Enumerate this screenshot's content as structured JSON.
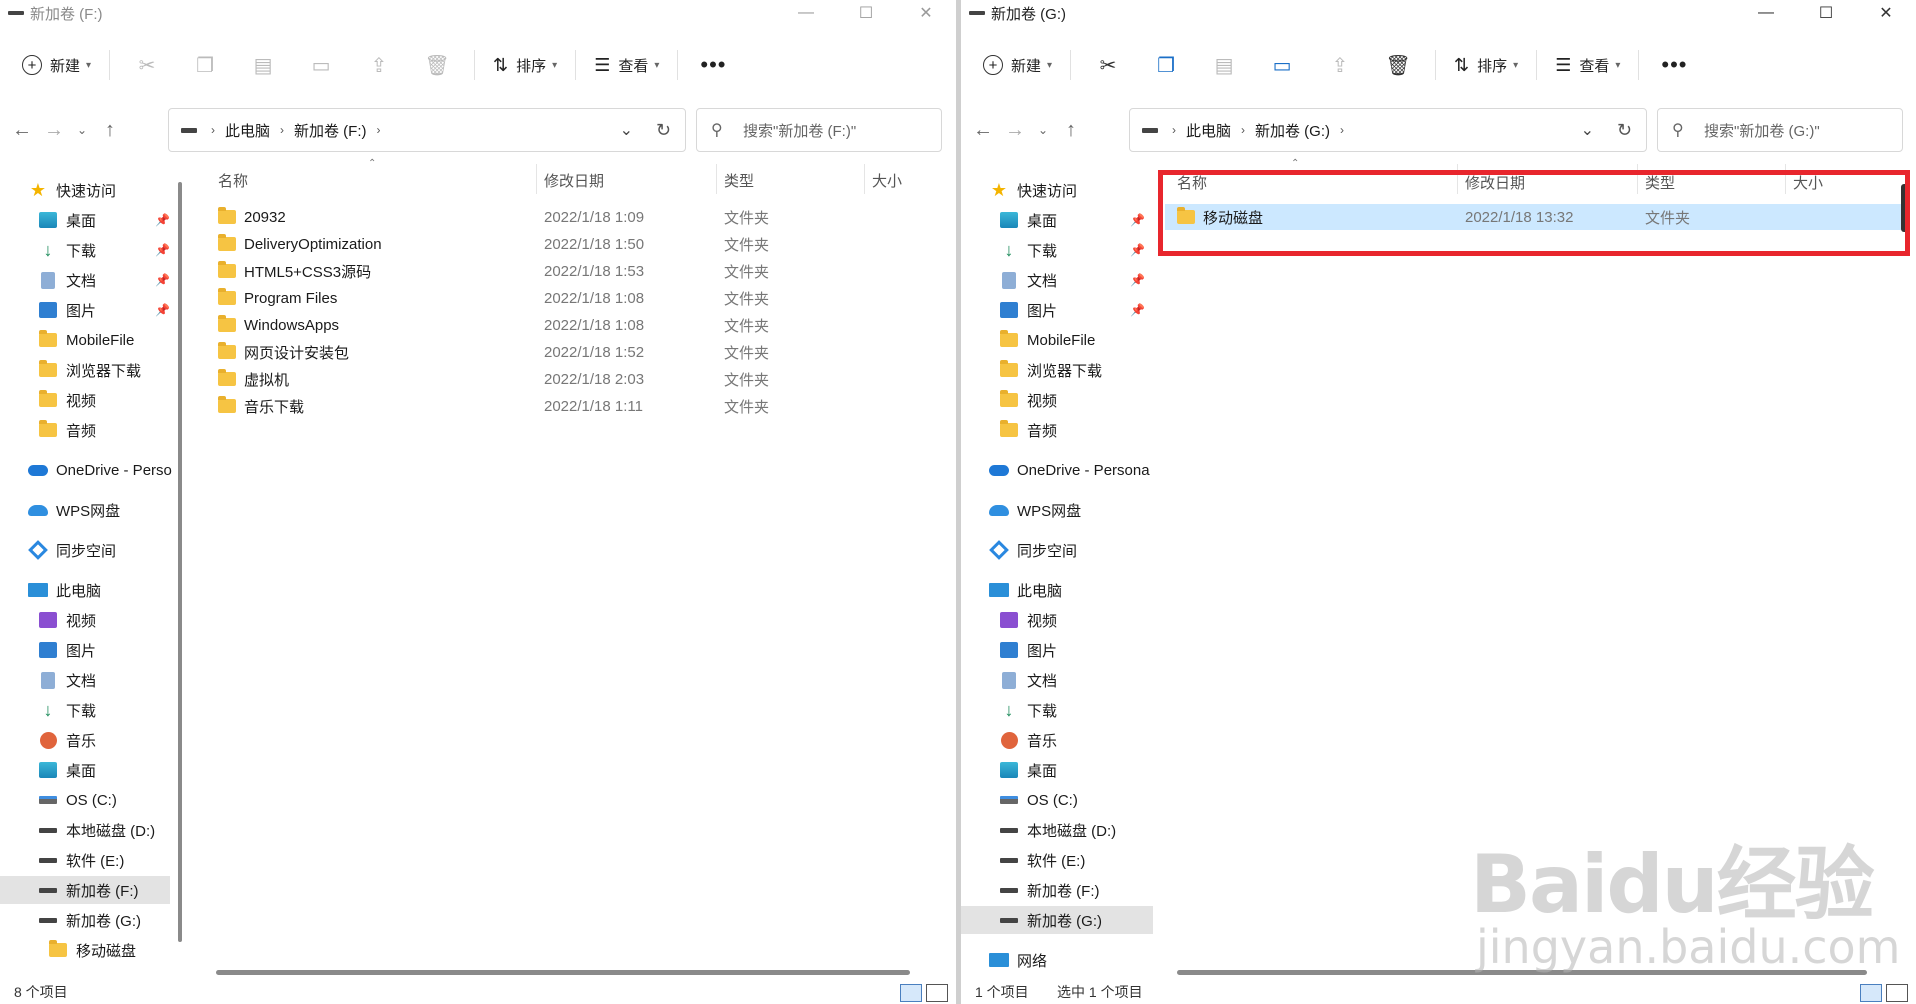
{
  "left": {
    "title": "新加卷 (F:)",
    "toolbar": {
      "new_label": "新建",
      "sort_label": "排序",
      "view_label": "查看"
    },
    "address": {
      "crumb1": "此电脑",
      "crumb2": "新加卷 (F:)"
    },
    "search_placeholder": "搜索\"新加卷 (F:)\"",
    "columns": {
      "name": "名称",
      "date": "修改日期",
      "type": "类型",
      "size": "大小"
    },
    "files": [
      {
        "name": "20932",
        "date": "2022/1/18 1:09",
        "type": "文件夹"
      },
      {
        "name": "DeliveryOptimization",
        "date": "2022/1/18 1:50",
        "type": "文件夹"
      },
      {
        "name": "HTML5+CSS3源码",
        "date": "2022/1/18 1:53",
        "type": "文件夹"
      },
      {
        "name": "Program Files",
        "date": "2022/1/18 1:08",
        "type": "文件夹"
      },
      {
        "name": "WindowsApps",
        "date": "2022/1/18 1:08",
        "type": "文件夹"
      },
      {
        "name": "网页设计安装包",
        "date": "2022/1/18 1:52",
        "type": "文件夹"
      },
      {
        "name": "虚拟机",
        "date": "2022/1/18 2:03",
        "type": "文件夹"
      },
      {
        "name": "音乐下载",
        "date": "2022/1/18 1:11",
        "type": "文件夹"
      }
    ],
    "status": {
      "count": "8 个项目"
    },
    "sidebar": {
      "quick": "快速访问",
      "desktop": "桌面",
      "downloads": "下载",
      "documents": "文档",
      "pictures": "图片",
      "mobilefile": "MobileFile",
      "browser_dl": "浏览器下载",
      "videos": "视频",
      "audio": "音频",
      "onedrive": "OneDrive - Perso",
      "wps": "WPS网盘",
      "sync": "同步空间",
      "pc": "此电脑",
      "pc_videos": "视频",
      "pc_pictures": "图片",
      "pc_docs": "文档",
      "pc_dl": "下载",
      "pc_music": "音乐",
      "pc_desktop": "桌面",
      "drive_c": "OS (C:)",
      "drive_d": "本地磁盘 (D:)",
      "drive_e": "软件 (E:)",
      "drive_f": "新加卷 (F:)",
      "drive_g": "新加卷 (G:)",
      "mobile_disk": "移动磁盘"
    }
  },
  "right": {
    "title": "新加卷 (G:)",
    "toolbar": {
      "new_label": "新建",
      "sort_label": "排序",
      "view_label": "查看"
    },
    "address": {
      "crumb1": "此电脑",
      "crumb2": "新加卷 (G:)"
    },
    "search_placeholder": "搜索\"新加卷 (G:)\"",
    "columns": {
      "name": "名称",
      "date": "修改日期",
      "type": "类型",
      "size": "大小"
    },
    "files": [
      {
        "name": "移动磁盘",
        "date": "2022/1/18 13:32",
        "type": "文件夹"
      }
    ],
    "status": {
      "count": "1 个项目",
      "selected": "选中 1 个项目"
    },
    "sidebar": {
      "quick": "快速访问",
      "desktop": "桌面",
      "downloads": "下载",
      "documents": "文档",
      "pictures": "图片",
      "mobilefile": "MobileFile",
      "browser_dl": "浏览器下载",
      "videos": "视频",
      "audio": "音频",
      "onedrive": "OneDrive - Persona",
      "wps": "WPS网盘",
      "sync": "同步空间",
      "pc": "此电脑",
      "pc_videos": "视频",
      "pc_pictures": "图片",
      "pc_docs": "文档",
      "pc_dl": "下载",
      "pc_music": "音乐",
      "pc_desktop": "桌面",
      "drive_c": "OS (C:)",
      "drive_d": "本地磁盘 (D:)",
      "drive_e": "软件 (E:)",
      "drive_f": "新加卷 (F:)",
      "drive_g": "新加卷 (G:)",
      "network": "网络"
    }
  },
  "watermark": {
    "main": "Baidu经验",
    "sub": "jingyan.baidu.com"
  },
  "colors": {
    "selection": "#cce8ff",
    "highlight": "#e8262d",
    "folder": "#f6c443"
  }
}
